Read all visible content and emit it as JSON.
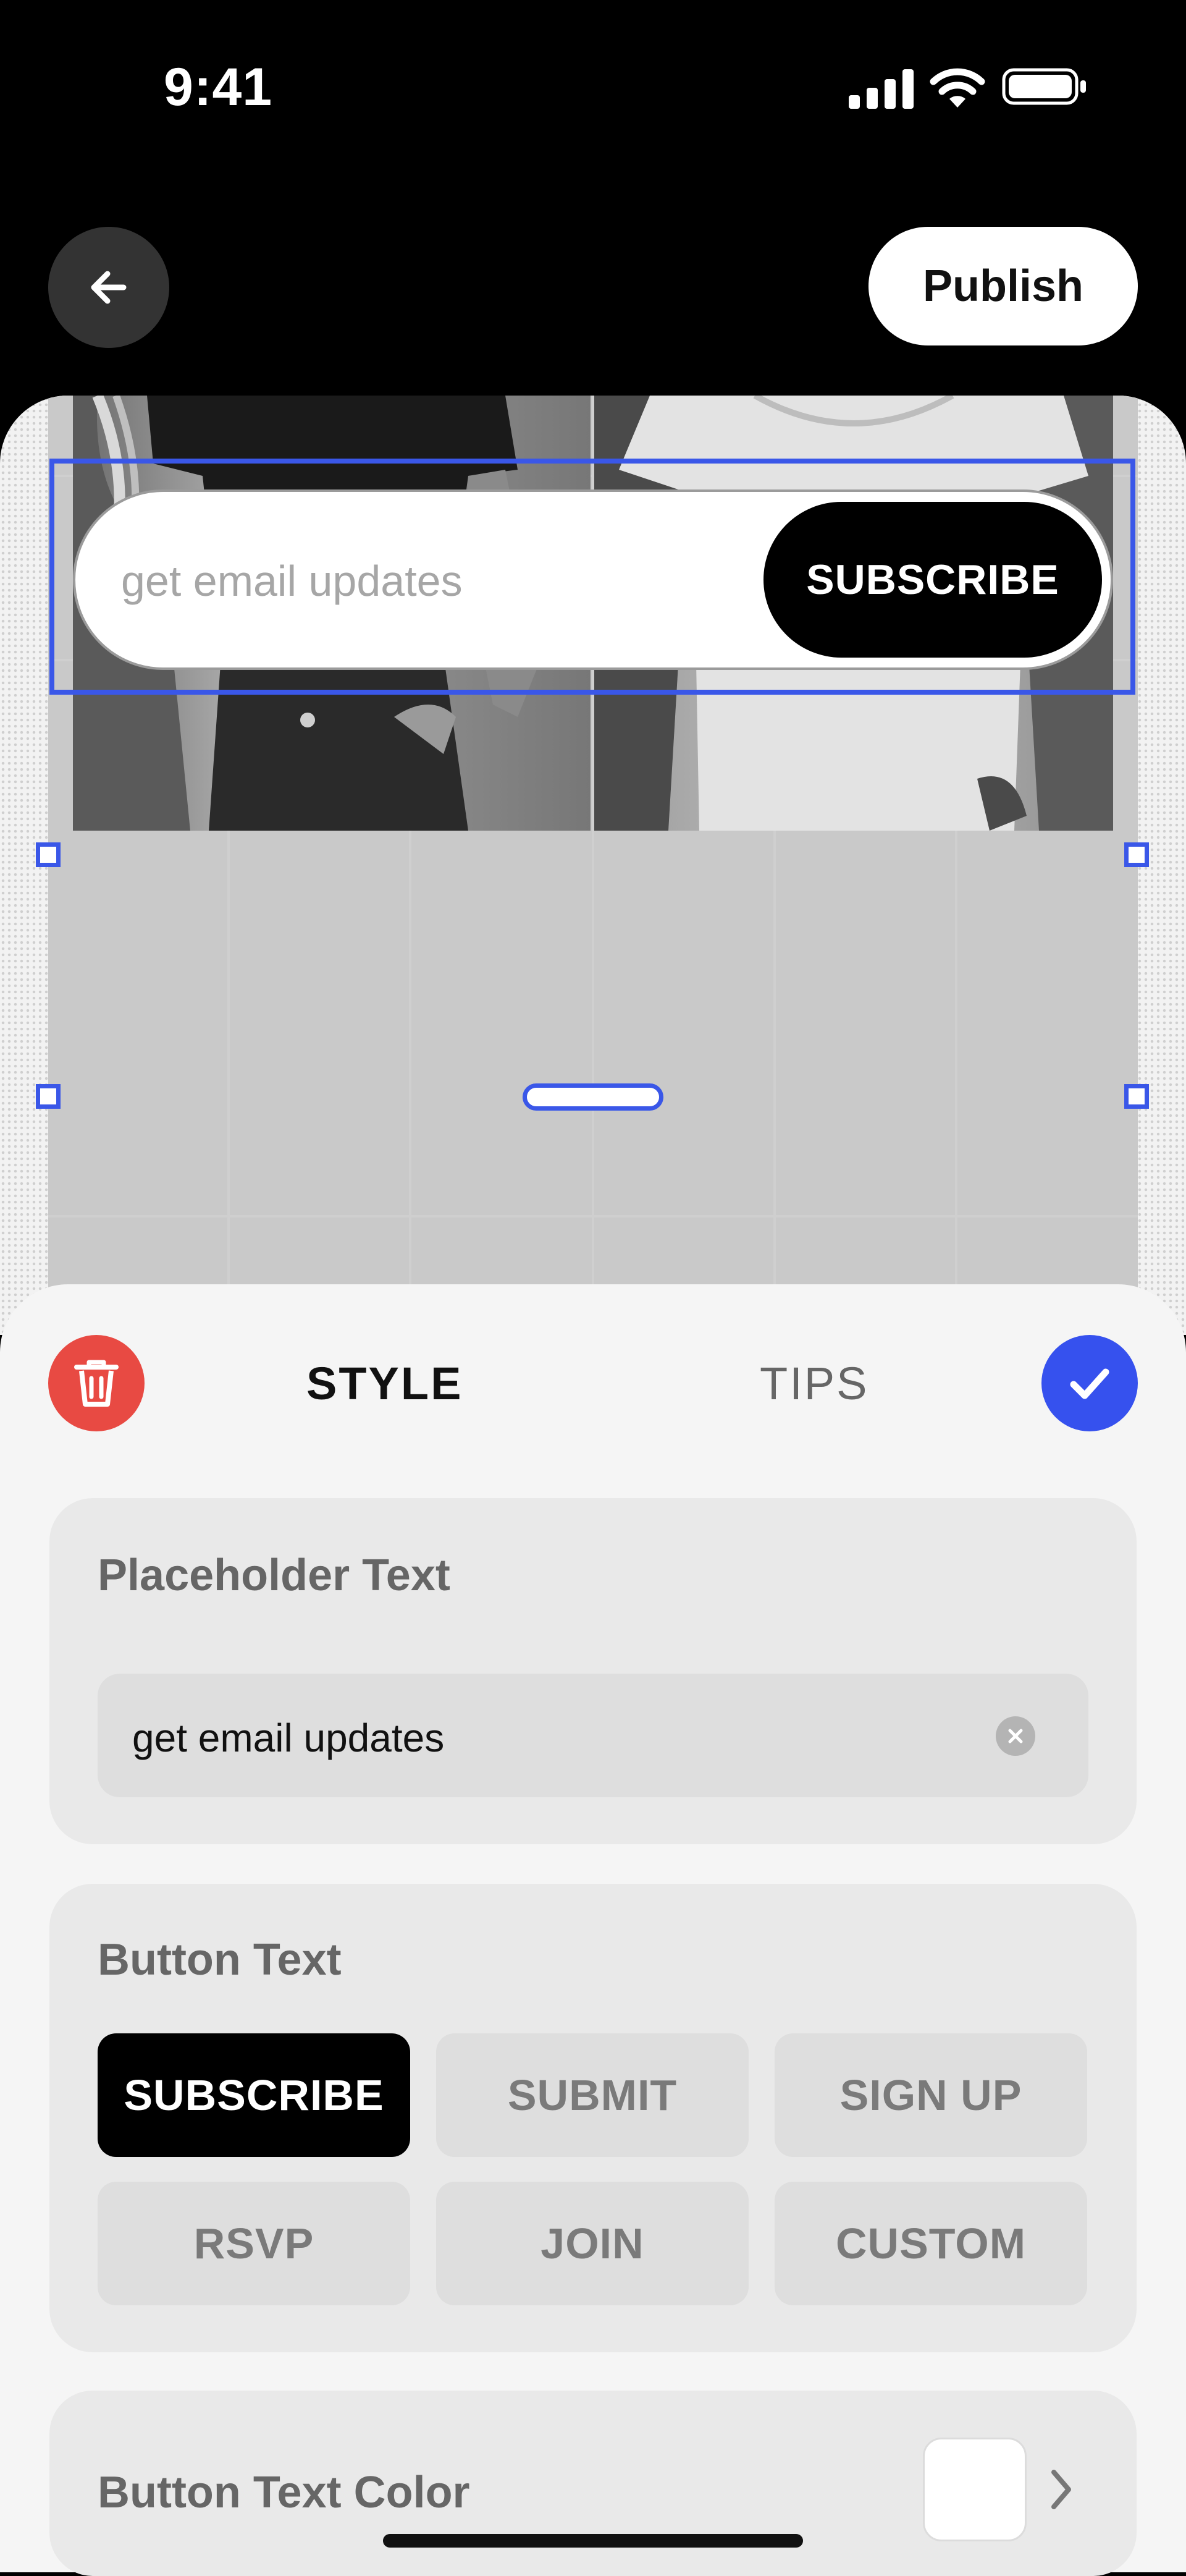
{
  "status_bar": {
    "time": "9:41"
  },
  "nav": {
    "publish_label": "Publish"
  },
  "canvas": {
    "email_widget": {
      "placeholder": "get email updates",
      "button_label": "SUBSCRIBE"
    }
  },
  "sheet": {
    "tabs": [
      {
        "label": "STYLE",
        "active": true
      },
      {
        "label": "TIPS",
        "active": false
      }
    ],
    "placeholder_card": {
      "title": "Placeholder Text",
      "value": "get email updates"
    },
    "button_text_card": {
      "title": "Button Text",
      "options": [
        "SUBSCRIBE",
        "SUBMIT",
        "SIGN UP",
        "RSVP",
        "JOIN",
        "CUSTOM"
      ],
      "selected": "SUBSCRIBE"
    },
    "text_color_card": {
      "title": "Button Text Color",
      "color": "#FFFFFF"
    }
  },
  "icons": {
    "back": "arrow-left-icon",
    "delete": "trash-icon",
    "confirm": "checkmark-icon",
    "clear": "clear-icon",
    "chevron": "chevron-right-icon"
  },
  "colors": {
    "accent_blue": "#3651EE",
    "selection_blue": "#3A57E8",
    "delete_red": "#E84A43"
  }
}
